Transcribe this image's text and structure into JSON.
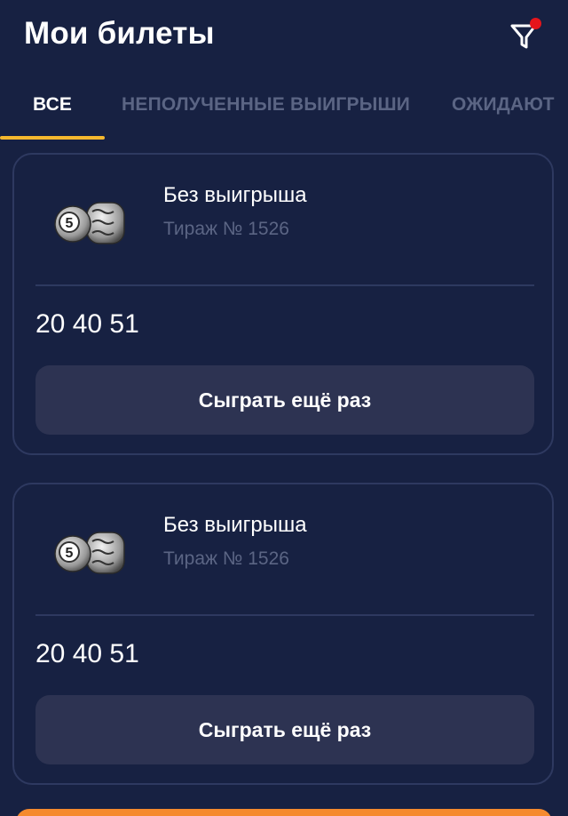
{
  "header": {
    "title": "Мои билеты",
    "filter_icon": "filter-icon",
    "filter_badge_color": "#e5151b"
  },
  "tabs": [
    {
      "label": "ВСЕ",
      "active": true
    },
    {
      "label": "НЕПОЛУЧЕННЫЕ ВЫИГРЫШИ",
      "active": false
    },
    {
      "label": "ОЖИДАЮТ",
      "active": false
    }
  ],
  "tickets": [
    {
      "icon": "lottery-barrel-icon",
      "status": "Без выигрыша",
      "draw": "Тираж № 1526",
      "numbers": "20 40 51",
      "action_label": "Сыграть ещё раз"
    },
    {
      "icon": "lottery-barrel-icon",
      "status": "Без выигрыша",
      "draw": "Тираж № 1526",
      "numbers": "20 40 51",
      "action_label": "Сыграть ещё раз"
    }
  ],
  "colors": {
    "background": "#172142",
    "accent": "#f5b82e",
    "button": "#2d3352",
    "bottom_bar": "#f58a2e"
  }
}
